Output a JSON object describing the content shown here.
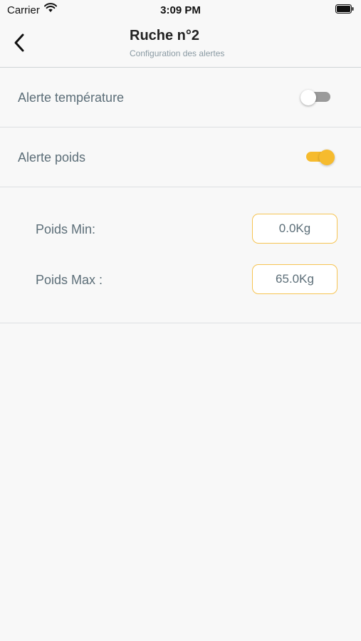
{
  "status_bar": {
    "carrier": "Carrier",
    "time": "3:09 PM",
    "icons": [
      "wifi-icon",
      "battery-icon"
    ]
  },
  "header": {
    "title": "Ruche n°2",
    "subtitle": "Configuration des alertes",
    "back_icon": "chevron-left-icon"
  },
  "alerts": {
    "temperature": {
      "label": "Alerte température",
      "enabled": false
    },
    "poids": {
      "label": "Alerte poids",
      "enabled": true
    }
  },
  "weight_settings": {
    "min": {
      "label": "Poids Min:",
      "value": "0.0Kg"
    },
    "max": {
      "label": "Poids Max :",
      "value": "65.0Kg"
    }
  },
  "colors": {
    "accent": "#f6bb2e",
    "toggle_off_track": "#9a9a9a",
    "label_text": "#5c6e78",
    "subtitle_text": "#8a9aa3",
    "background": "#f8f8f8"
  }
}
